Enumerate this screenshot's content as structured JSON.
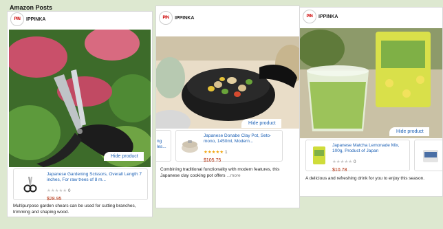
{
  "section": {
    "title": "Amazon Posts"
  },
  "posts": [
    {
      "brand": "IPPINKA",
      "logo_text": "PIN",
      "hide_label": "Hide product",
      "product": {
        "title": "Japanese Gardening Scissors, Overall Length 7 inches, For raw trees of 8 m...",
        "stars": "★★★★★",
        "count": "0",
        "price": "$28.95"
      },
      "description": "Multipurpose garden shears can be used for cutting branches, trimming and shaping wood."
    },
    {
      "brand": "IPPINKA",
      "logo_text": "PIN",
      "hide_label": "Hide product",
      "side_fragment": "ng\nles...",
      "product": {
        "title": "Japanese Donabe Clay Pot, Seto-mono, 1450ml, Modern...",
        "stars": "★★★★★",
        "count": "1",
        "price": "$105.75"
      },
      "description": "Combining traditional functionality with modern features, this Japanese clay cooking pot offers",
      "more_label": "...more"
    },
    {
      "brand": "IPPINKA",
      "logo_text": "PIN",
      "hide_label": "Hide product",
      "product": {
        "title": "Japanese Matcha Lemonade Mix, 100g, Product of Japan",
        "stars": "★★★★★",
        "count": "0",
        "price": "$10.78"
      },
      "description": "A delicious and refreshing drink for you to enjoy this season."
    }
  ]
}
